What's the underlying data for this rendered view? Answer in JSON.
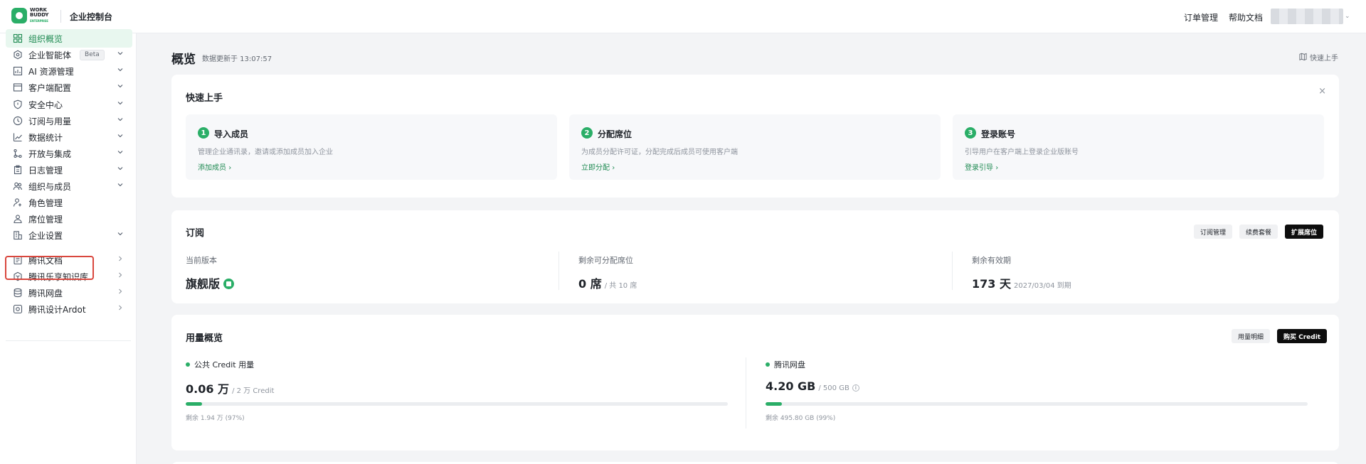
{
  "topbar": {
    "logo_line1": "WORK",
    "logo_line2": "BUDDY",
    "logo_sub": "ENTERPRISE",
    "title": "企业控制台",
    "links": [
      "订单管理",
      "帮助文档"
    ]
  },
  "sidebar": {
    "items": [
      {
        "label": "组织概览",
        "icon": "grid-icon",
        "active": true,
        "caret": "none"
      },
      {
        "label": "企业智能体",
        "icon": "hexagon-icon",
        "badge": "Beta",
        "caret": "down"
      },
      {
        "label": "AI 资源管理",
        "icon": "image-chart-icon",
        "caret": "down"
      },
      {
        "label": "客户端配置",
        "icon": "window-icon",
        "caret": "down"
      },
      {
        "label": "安全中心",
        "icon": "shield-icon",
        "caret": "down"
      },
      {
        "label": "订阅与用量",
        "icon": "clock-icon",
        "caret": "down"
      },
      {
        "label": "数据统计",
        "icon": "line-chart-icon",
        "caret": "down"
      },
      {
        "label": "开放与集成",
        "icon": "branch-icon",
        "caret": "down"
      },
      {
        "label": "日志管理",
        "icon": "clipboard-icon",
        "caret": "down"
      },
      {
        "label": "组织与成员",
        "icon": "users-icon",
        "caret": "down"
      },
      {
        "label": "角色管理",
        "icon": "user-settings-icon",
        "caret": "none"
      },
      {
        "label": "席位管理",
        "icon": "seat-user-icon",
        "caret": "none"
      },
      {
        "label": "企业设置",
        "icon": "building-settings-icon",
        "caret": "down"
      },
      {
        "label": "腾讯文档",
        "icon": "docs-icon",
        "caret": "right"
      },
      {
        "label": "腾讯乐享知识库",
        "icon": "knowledge-icon",
        "caret": "right"
      },
      {
        "label": "腾讯网盘",
        "icon": "database-icon",
        "caret": "right"
      },
      {
        "label": "腾讯设计Ardot",
        "icon": "design-icon",
        "caret": "right"
      }
    ]
  },
  "main": {
    "title": "概览",
    "update_time": "数据更新于 13:07:57",
    "quick_start_link": "快速上手",
    "quick_start": {
      "title": "快速上手",
      "close": "×",
      "steps": [
        {
          "num": "1",
          "title": "导入成员",
          "desc": "管理企业通讯录，邀请或添加成员加入企业",
          "link": "添加成员"
        },
        {
          "num": "2",
          "title": "分配席位",
          "desc": "为成员分配许可证，分配完成后成员可使用客户端",
          "link": "立即分配"
        },
        {
          "num": "3",
          "title": "登录账号",
          "desc": "引导用户在客户端上登录企业版账号",
          "link": "登录引导"
        }
      ]
    },
    "subscription": {
      "title": "订阅",
      "buttons": {
        "order": "订阅管理",
        "renew": "续费套餐",
        "expand": "扩展席位"
      },
      "edition_label": "当前版本",
      "edition_value": "旗舰版",
      "seats_label": "剩余可分配席位",
      "seats_value": "0 席",
      "seats_total": "/ 共 10 席",
      "validity_label": "剩余有效期",
      "validity_value": "173 天",
      "validity_date": "2027/03/04 到期"
    },
    "usage": {
      "title": "用量概览",
      "buttons": {
        "detail": "用量明细",
        "buy": "购买 Credit"
      },
      "credit": {
        "label": "公共 Credit 用量",
        "value": "0.06 万",
        "total": "/ 2 万 Credit",
        "remain": "剩余 1.94 万 (97%)",
        "used_fraction": 0.03
      },
      "disk": {
        "label": "腾讯网盘",
        "value": "4.20 GB",
        "total": "/ 500 GB",
        "remain": "剩余 495.80 GB (99%)",
        "used_fraction": 0.0084
      }
    }
  },
  "colors": {
    "accent": "#2aae67",
    "active_bg": "#e8f7ef",
    "highlight": "#d9473e"
  }
}
